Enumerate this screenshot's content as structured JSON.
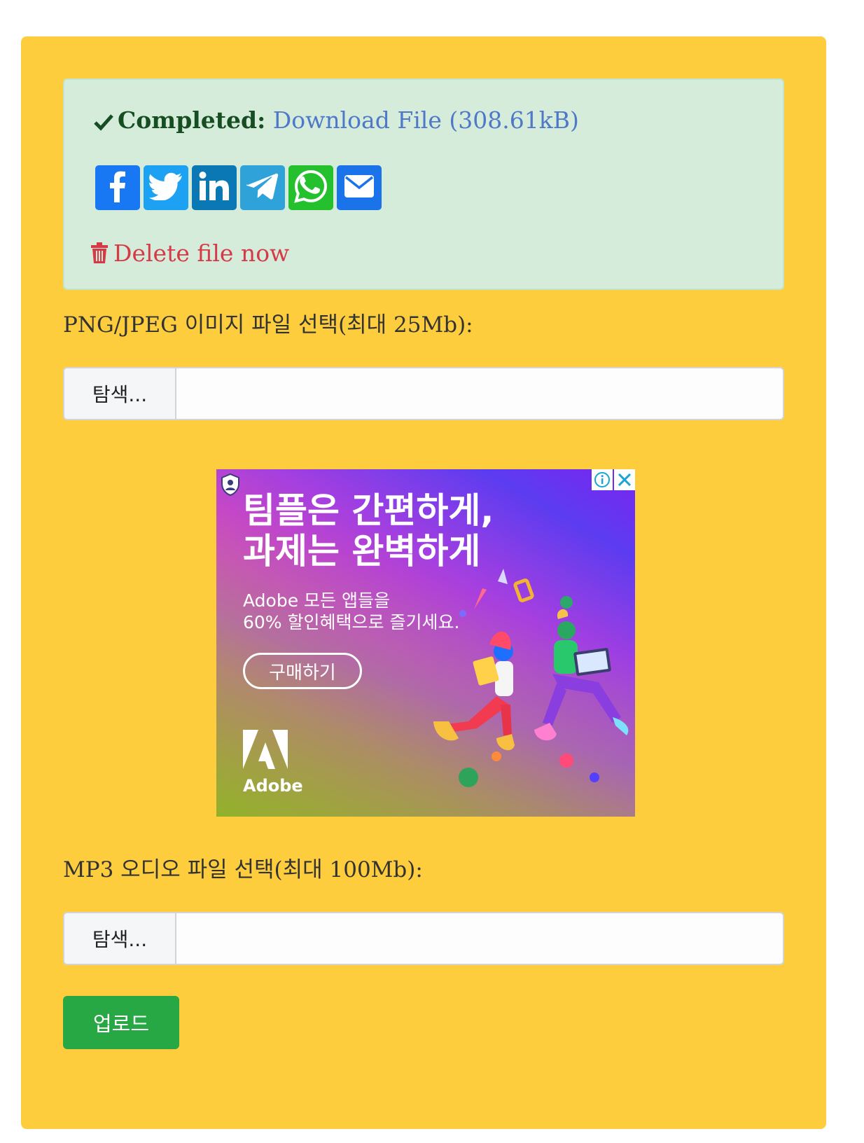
{
  "status": {
    "completed_label": "Completed:",
    "download_text": "Download File (308.61kB)",
    "delete_text": "Delete file now"
  },
  "share_buttons": [
    {
      "icon": "facebook-icon",
      "color": "#1877f2"
    },
    {
      "icon": "twitter-icon",
      "color": "#1da1f2"
    },
    {
      "icon": "linkedin-icon",
      "color": "#0a78b5"
    },
    {
      "icon": "telegram-icon",
      "color": "#2fa3d9"
    },
    {
      "icon": "whatsapp-icon",
      "color": "#25c02d"
    },
    {
      "icon": "email-icon",
      "color": "#1a73e8"
    }
  ],
  "image_upload": {
    "label": "PNG/JPEG 이미지 파일 선택(최대 25Mb):",
    "browse_label": "탐색..."
  },
  "ad": {
    "headline_line1": "팀플은 간편하게,",
    "headline_line2": "과제는 완벽하게",
    "sub_line1": "Adobe 모든 앱들을",
    "sub_line2": "60% 할인혜택으로 즐기세요.",
    "cta_label": "구매하기",
    "brand": "Adobe"
  },
  "audio_upload": {
    "label": "MP3 오디오 파일 선택(최대 100Mb):",
    "browse_label": "탐색..."
  },
  "upload_button_label": "업로드"
}
